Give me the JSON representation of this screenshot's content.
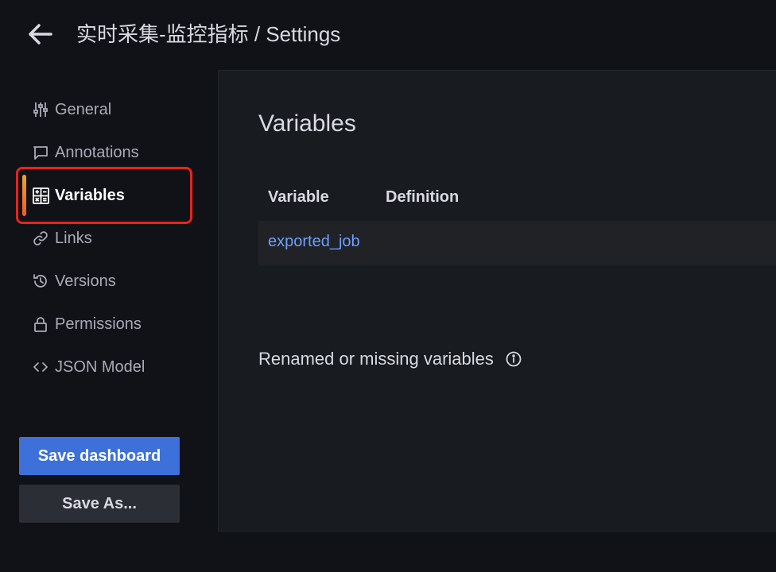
{
  "header": {
    "title": "实时采集-监控指标 / Settings",
    "back_icon": "arrow-left-icon"
  },
  "sidebar": {
    "items": [
      {
        "label": "General",
        "icon": "sliders-icon",
        "active": false
      },
      {
        "label": "Annotations",
        "icon": "comment-icon",
        "active": false
      },
      {
        "label": "Variables",
        "icon": "calculator-icon",
        "active": true
      },
      {
        "label": "Links",
        "icon": "link-icon",
        "active": false
      },
      {
        "label": "Versions",
        "icon": "history-icon",
        "active": false
      },
      {
        "label": "Permissions",
        "icon": "lock-icon",
        "active": false
      },
      {
        "label": "JSON Model",
        "icon": "code-icon",
        "active": false
      }
    ],
    "save_label": "Save dashboard",
    "save_as_label": "Save As..."
  },
  "main": {
    "title": "Variables",
    "columns": [
      "Variable",
      "Definition"
    ],
    "rows": [
      {
        "variable": "exported_job",
        "definition": ""
      }
    ],
    "renamed_label": "Renamed or missing variables"
  },
  "colors": {
    "background": "#111217",
    "panel": "#181b1f",
    "primary_button": "#3d71d9",
    "link": "#6e9fff",
    "highlight": "#e9231c"
  }
}
